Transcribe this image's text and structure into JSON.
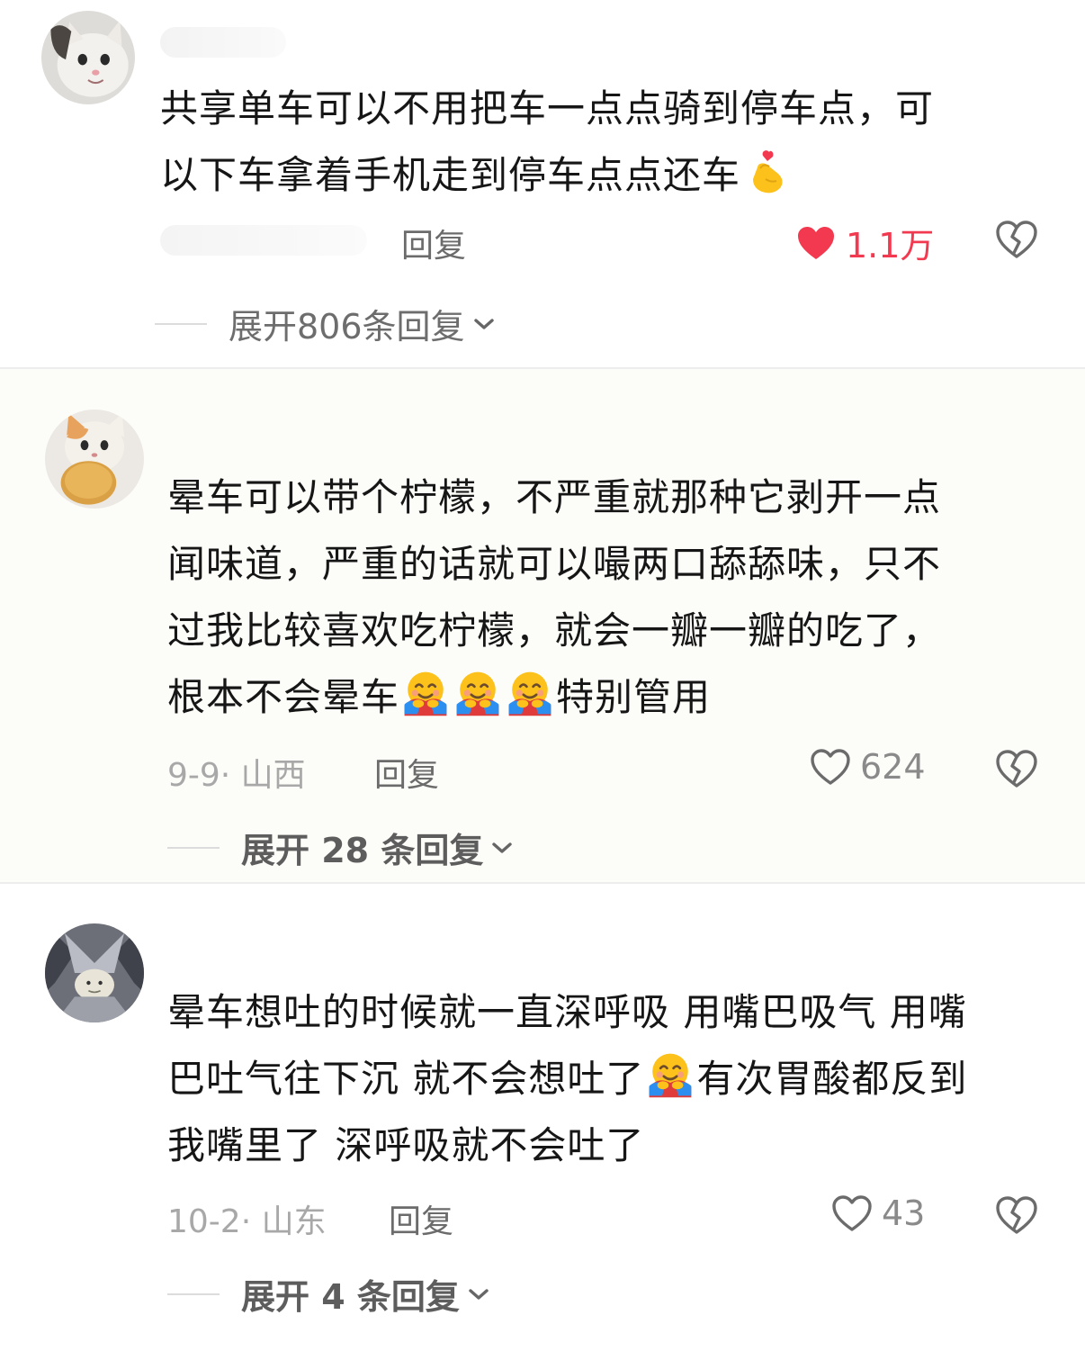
{
  "comments": [
    {
      "text_line1": "共享单车可以不用把车一点点骑到停车点，可",
      "text_line2": "以下车拿着手机走到停车点点还车",
      "emoji": "finger-heart-emoji",
      "meta": "",
      "reply_label": "回复",
      "likes": "1.1万",
      "liked": true,
      "expand_label": "展开806条回复"
    },
    {
      "text_line1": "晕车可以带个柠檬，不严重就那种它剥开一点",
      "text_line2": "闻味道，严重的话就可以嘬两口舔舔味，只不",
      "text_line3": "过我比较喜欢吃柠檬，就会一瓣一瓣的吃了，",
      "text_line4_a": "根本不会晕车",
      "text_line4_b": "特别管用",
      "emoji": "hugging-face-emoji",
      "meta": "9-9· 山西",
      "reply_label": "回复",
      "likes": "624",
      "liked": false,
      "expand_label": "展开 28 条回复"
    },
    {
      "text_line1": "晕车想吐的时候就一直深呼吸 用嘴巴吸气 用嘴",
      "text_line2_a": "巴吐气往下沉 就不会想吐了",
      "text_line2_b": "有次胃酸都反到",
      "text_line3": "我嘴里了 深呼吸就不会吐了",
      "emoji": "hugging-face-emoji",
      "meta": "10-2· 山东",
      "reply_label": "回复",
      "likes": "43",
      "liked": false,
      "expand_label": "展开 4 条回复"
    }
  ],
  "colors": {
    "liked": "#f2394f",
    "muted": "#a8a8a8",
    "text": "#161616"
  }
}
